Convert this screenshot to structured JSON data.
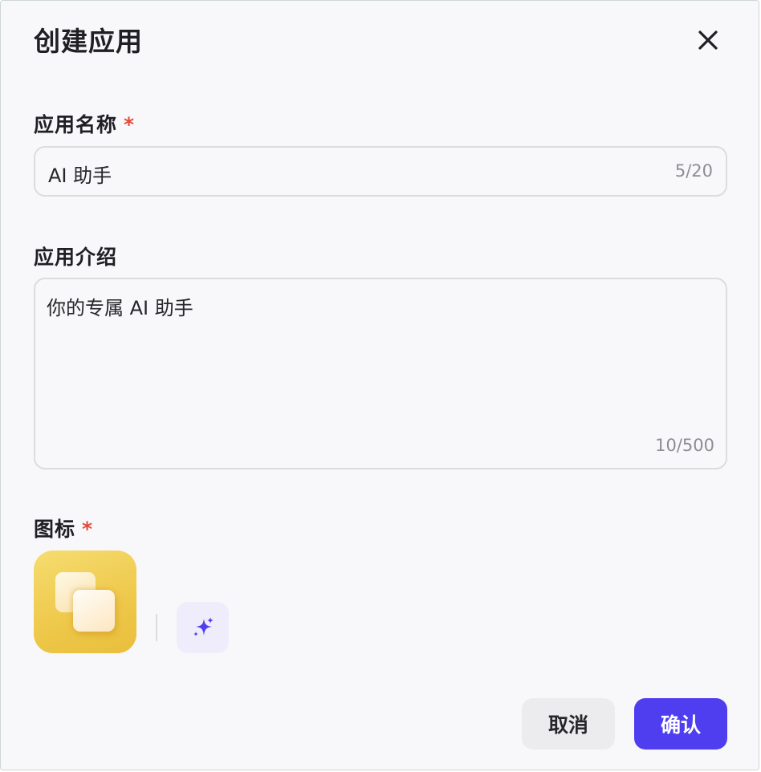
{
  "dialog": {
    "title": "创建应用",
    "close_icon": "close-icon"
  },
  "app_name": {
    "label": "应用名称",
    "required_mark": "*",
    "value": "AI 助手",
    "counter": "5/20"
  },
  "app_intro": {
    "label": "应用介绍",
    "value": "你的专属 AI 助手",
    "counter": "10/500"
  },
  "icon_section": {
    "label": "图标",
    "required_mark": "*",
    "app_icon": "stacked-squares-icon",
    "ai_generate_icon": "sparkle-icon"
  },
  "footer": {
    "cancel_label": "取消",
    "confirm_label": "确认"
  },
  "colors": {
    "accent": "#4f3ef0",
    "required": "#e5483a",
    "icon_bg": "#eec84a"
  }
}
